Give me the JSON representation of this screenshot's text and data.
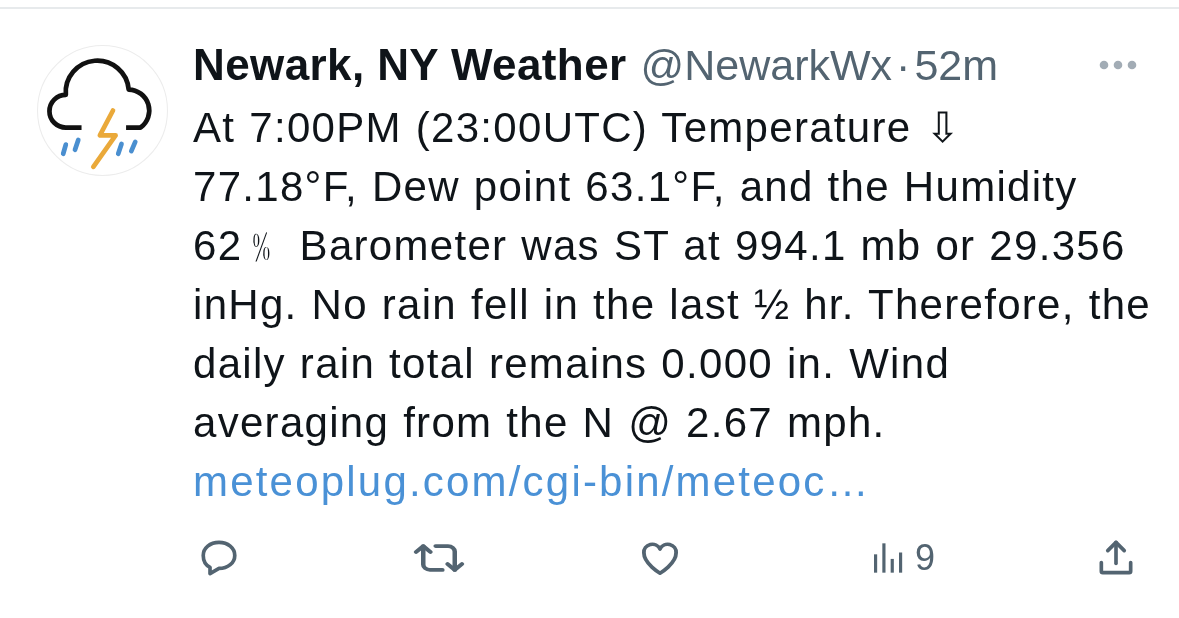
{
  "tweet": {
    "author": {
      "name": "Newark, NY Weather",
      "handle": "@NewarkWx",
      "separator": "·",
      "time": "52m"
    },
    "text": "At 7:00PM (23:00UTC) Temperature ⇩\n77.18°F, Dew point 63.1°F, and the Humidity\n62﹪ Barometer was ST at 994.1 mb or 29.356\ninHg. No rain fell in the last ½ hr. Therefore, the\ndaily rain total remains 0.000 in. Wind\naveraging from the N @ 2.67 mph.",
    "link": "meteoplug.com/cgi-bin/meteoc…",
    "actions": [
      {
        "kind": "reply"
      },
      {
        "kind": "repost"
      },
      {
        "kind": "like"
      },
      {
        "kind": "views",
        "count": "9"
      },
      {
        "kind": "share"
      }
    ]
  }
}
